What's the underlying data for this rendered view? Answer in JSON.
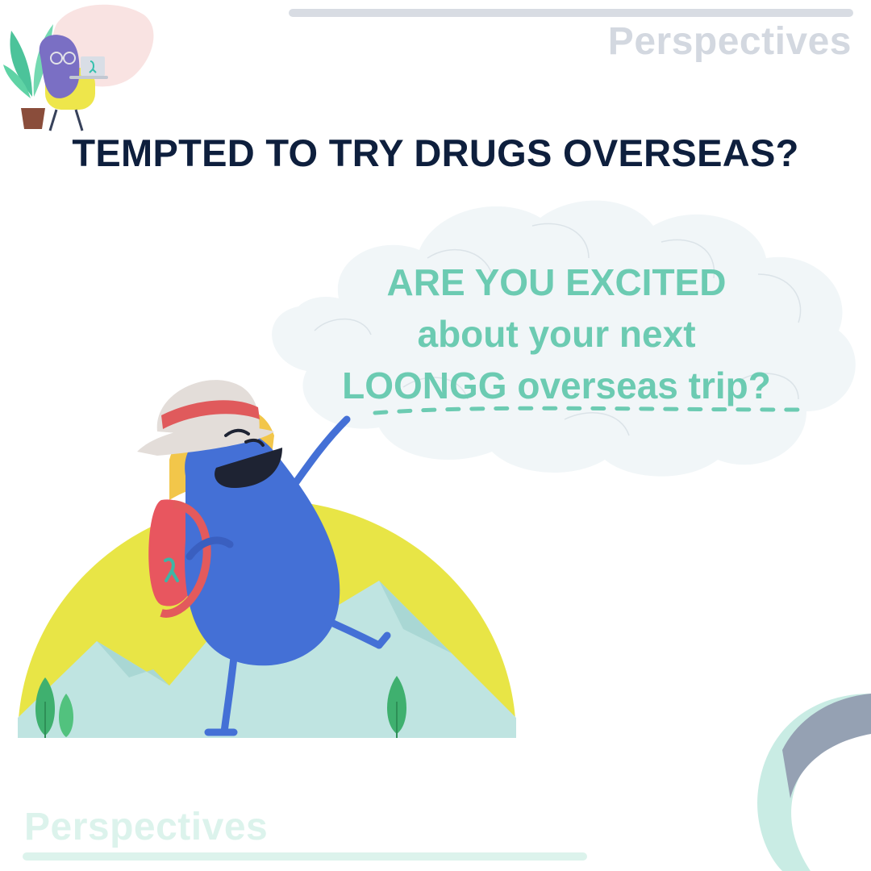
{
  "brand": {
    "top_logo_text": "Perspectives",
    "bottom_logo_text": "Perspectives"
  },
  "headline": "TEMPTED TO TRY DRUGS OVERSEAS?",
  "thought_bubble": {
    "line1": "ARE YOU EXCITED",
    "line2": "about your next",
    "line3": "LOONGG overseas trip?"
  },
  "colors": {
    "headline": "#0e1f3d",
    "accent_teal": "#6ccbb2",
    "character_blue": "#4470d6",
    "sun_yellow": "#e8e546",
    "mountain_mint": "#bfe4e1",
    "backpack_red": "#e8565f"
  },
  "illustrations": {
    "corner_mascot": "mascot-at-laptop-icon",
    "main_character": "traveler-bean-with-hat-and-backpack",
    "ribbon": "teal-awareness-ribbon-icon"
  }
}
